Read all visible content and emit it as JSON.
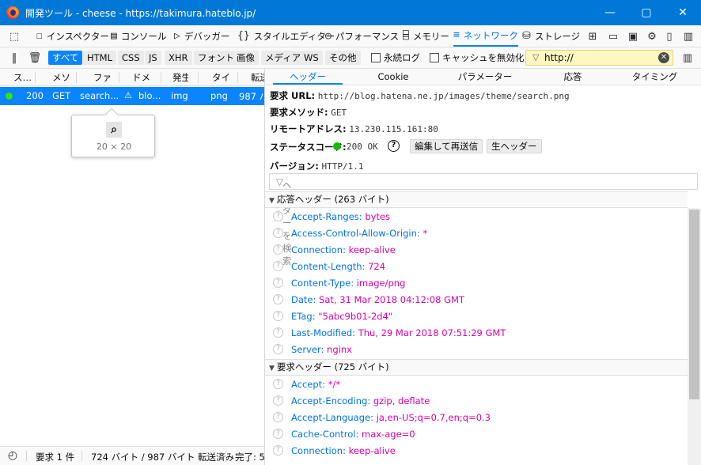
{
  "window": {
    "title": "開発ツール - cheese - https://takimura.hateblo.jp/",
    "controls": [
      "minimize",
      "maximize",
      "close"
    ]
  },
  "toolbar": {
    "tabs": [
      {
        "label": "インスペクター",
        "icon": "inspector-icon"
      },
      {
        "label": "コンソール",
        "icon": "console-icon"
      },
      {
        "label": "デバッガー",
        "icon": "debugger-icon"
      },
      {
        "label": "スタイルエディター",
        "icon": "style-editor-icon"
      },
      {
        "label": "パフォーマンス",
        "icon": "performance-icon"
      },
      {
        "label": "メモリー",
        "icon": "memory-icon"
      },
      {
        "label": "ネットワーク",
        "icon": "network-icon",
        "active": true
      },
      {
        "label": "ストレージ",
        "icon": "storage-icon"
      }
    ]
  },
  "filters": {
    "types": [
      "すべて",
      "HTML",
      "CSS",
      "JS",
      "XHR",
      "フォント",
      "画像",
      "メディア",
      "WS",
      "その他"
    ],
    "active": "すべて",
    "persist_label": "永続ログ",
    "disable_cache_label": "キャッシュを無効化",
    "url_filter": "http://"
  },
  "request_list": {
    "columns": [
      "ス…",
      "メソ",
      "ファ",
      "ドメ",
      "発生",
      "タイ",
      "転送"
    ],
    "rows": [
      {
        "status": "200",
        "method": "GET",
        "file": "search....",
        "domain": "blo...",
        "cause": "img",
        "type": "png",
        "transferred": "987 バ"
      }
    ],
    "tooltip_dims": "20 × 20"
  },
  "status_bar": {
    "requests": "要求 1 件",
    "size": "724 バイト / 987 バイト 転送済み",
    "finish": "完了: 5..."
  },
  "details": {
    "tabs": [
      "ヘッダー",
      "Cookie",
      "パラメーター",
      "応答",
      "タイミング"
    ],
    "active_tab": "ヘッダー",
    "url_label": "要求 URL:",
    "url": "http://blog.hatena.ne.jp/images/theme/search.png",
    "method_label": "要求メソッド:",
    "method": "GET",
    "remote_label": "リモートアドレス:",
    "remote": "13.230.115.161:80",
    "status_label": "ステータスコード:",
    "status": "200 OK",
    "status_color": "#30e60b",
    "edit_resend": "編集して再送信",
    "raw_headers": "生ヘッダー",
    "version_label": "バージョン:",
    "version": "HTTP/1.1",
    "filter_placeholder": "ヘッダーを検索",
    "response_section": "応答ヘッダー (263 バイト)",
    "response_headers": [
      {
        "name": "Accept-Ranges:",
        "value": "bytes"
      },
      {
        "name": "Access-Control-Allow-Origin:",
        "value": "*"
      },
      {
        "name": "Connection:",
        "value": "keep-alive"
      },
      {
        "name": "Content-Length:",
        "value": "724"
      },
      {
        "name": "Content-Type:",
        "value": "image/png"
      },
      {
        "name": "Date:",
        "value": "Sat, 31 Mar 2018 04:12:08 GMT"
      },
      {
        "name": "ETag:",
        "value": "\"5abc9b01-2d4\""
      },
      {
        "name": "Last-Modified:",
        "value": "Thu, 29 Mar 2018 07:51:29 GMT"
      },
      {
        "name": "Server:",
        "value": "nginx"
      }
    ],
    "request_section": "要求ヘッダー (725 バイト)",
    "request_headers": [
      {
        "name": "Accept:",
        "value": "*/*"
      },
      {
        "name": "Accept-Encoding:",
        "value": "gzip, deflate"
      },
      {
        "name": "Accept-Language:",
        "value": "ja,en-US;q=0.7,en;q=0.3"
      },
      {
        "name": "Cache-Control:",
        "value": "max-age=0"
      },
      {
        "name": "Connection:",
        "value": "keep-alive"
      }
    ]
  },
  "colors": {
    "accent": "#0a84ff",
    "titlebar": "#0078d7",
    "header_name": "#0074e8",
    "header_value": "#dd00a9",
    "filter_bg": "#fff7c2"
  }
}
